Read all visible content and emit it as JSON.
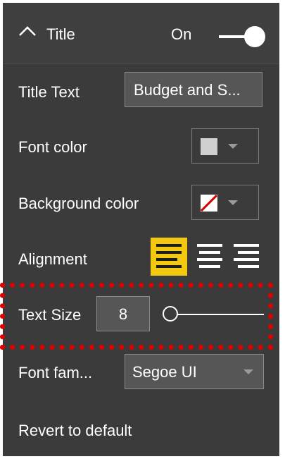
{
  "section": {
    "title": "Title",
    "toggle_label": "On",
    "toggle_on": true
  },
  "title_text": {
    "label": "Title Text",
    "value": "Budget and S..."
  },
  "font_color": {
    "label": "Font color",
    "swatch": "#d0d0d0",
    "icon": "chevron-down-icon"
  },
  "background_color": {
    "label": "Background color",
    "swatch": "none",
    "icon": "no-color-icon"
  },
  "alignment": {
    "label": "Alignment",
    "options": [
      "left",
      "center",
      "right"
    ],
    "selected": "left",
    "selected_color": "#f2c811"
  },
  "text_size": {
    "label": "Text Size",
    "value": "8",
    "slider_level": 0
  },
  "font_family": {
    "label": "Font fam...",
    "value": "Segoe UI"
  },
  "revert": {
    "label": "Revert to default"
  },
  "highlight_color": "#e00000"
}
